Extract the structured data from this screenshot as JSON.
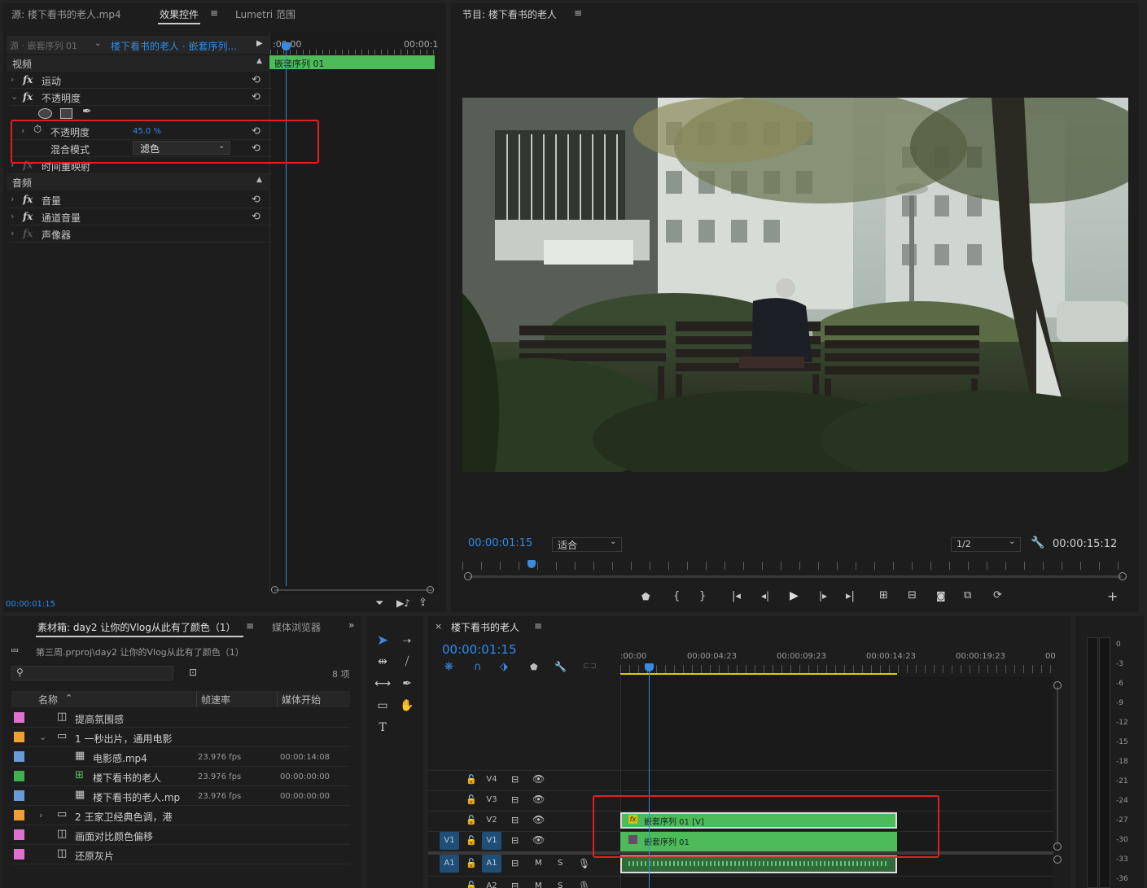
{
  "source_panel": {
    "tab_source": "源: 楼下看书的老人.mp4",
    "tab_effects": "效果控件",
    "tab_lumetri": "Lumetri 范围",
    "source_selector": "源 · 嵌套序列 01",
    "sequence_selector": "楼下看书的老人 · 嵌套序列...",
    "time_start": ":00:00",
    "time_end": "00:00:1",
    "clip_name": "嵌套序列 01",
    "section_video": "视频",
    "effects": [
      {
        "label": "运动"
      },
      {
        "label": "不透明度"
      }
    ],
    "opacity_label": "不透明度",
    "opacity_value": "45.0 %",
    "blend_label": "混合模式",
    "blend_value": "滤色",
    "time_remap": "时间重映射",
    "section_audio": "音频",
    "audio_effects": [
      {
        "label": "音量"
      },
      {
        "label": "通道音量"
      },
      {
        "label": "声像器"
      }
    ],
    "timecode": "00:00:01:15"
  },
  "program_panel": {
    "title": "节目: 楼下看书的老人",
    "timecode": "00:00:01:15",
    "fit": "适合",
    "resolution": "1/2",
    "duration": "00:00:15:12"
  },
  "project_panel": {
    "tab_bin": "素材箱: day2 让你的Vlog从此有了颜色（1）",
    "tab_media": "媒体浏览器",
    "path": "第三周.prproj\\day2 让你的Vlog从此有了颜色（1）",
    "item_count": "8 项",
    "col_name": "名称",
    "col_fps": "帧速率",
    "col_start": "媒体开始",
    "items": [
      {
        "name": "提高氛围感",
        "fps": "",
        "start": "",
        "color": "#e070d0"
      },
      {
        "name": "1 一秒出片，通用电影",
        "fps": "",
        "start": "",
        "color": "#f0a030"
      },
      {
        "name": "电影感.mp4",
        "fps": "23.976 fps",
        "start": "00:00:14:08",
        "color": "#6a9ad8"
      },
      {
        "name": "楼下看书的老人",
        "fps": "23.976 fps",
        "start": "00:00:00:00",
        "color": "#40b050"
      },
      {
        "name": "楼下看书的老人.mp",
        "fps": "23.976 fps",
        "start": "00:00:00:00",
        "color": "#6a9ad8"
      },
      {
        "name": "2 王家卫经典色调，港",
        "fps": "",
        "start": "",
        "color": "#f0a030"
      },
      {
        "name": "画面对比颜色偏移",
        "fps": "",
        "start": "",
        "color": "#e070d0"
      },
      {
        "name": "还原灰片",
        "fps": "",
        "start": "",
        "color": "#e070d0"
      }
    ]
  },
  "timeline_panel": {
    "title": "楼下看书的老人",
    "timecode": "00:00:01:15",
    "ruler": [
      ":00:00",
      "00:00:04:23",
      "00:00:09:23",
      "00:00:14:23",
      "00:00:19:23",
      "00"
    ],
    "tracks_video": [
      "V4",
      "V3",
      "V2",
      "V1"
    ],
    "tracks_audio": [
      "A1",
      "A2"
    ],
    "src_v1": "V1",
    "src_a1": "A1",
    "clip_v2": "嵌套序列 01 [V]",
    "clip_v1": "嵌套序列 01",
    "m_label": "M",
    "s_label": "S"
  },
  "meter": {
    "scale": [
      "0",
      "-3",
      "-6",
      "-9",
      "-12",
      "-15",
      "-18",
      "-21",
      "-24",
      "-27",
      "-30",
      "-33",
      "-36"
    ]
  }
}
